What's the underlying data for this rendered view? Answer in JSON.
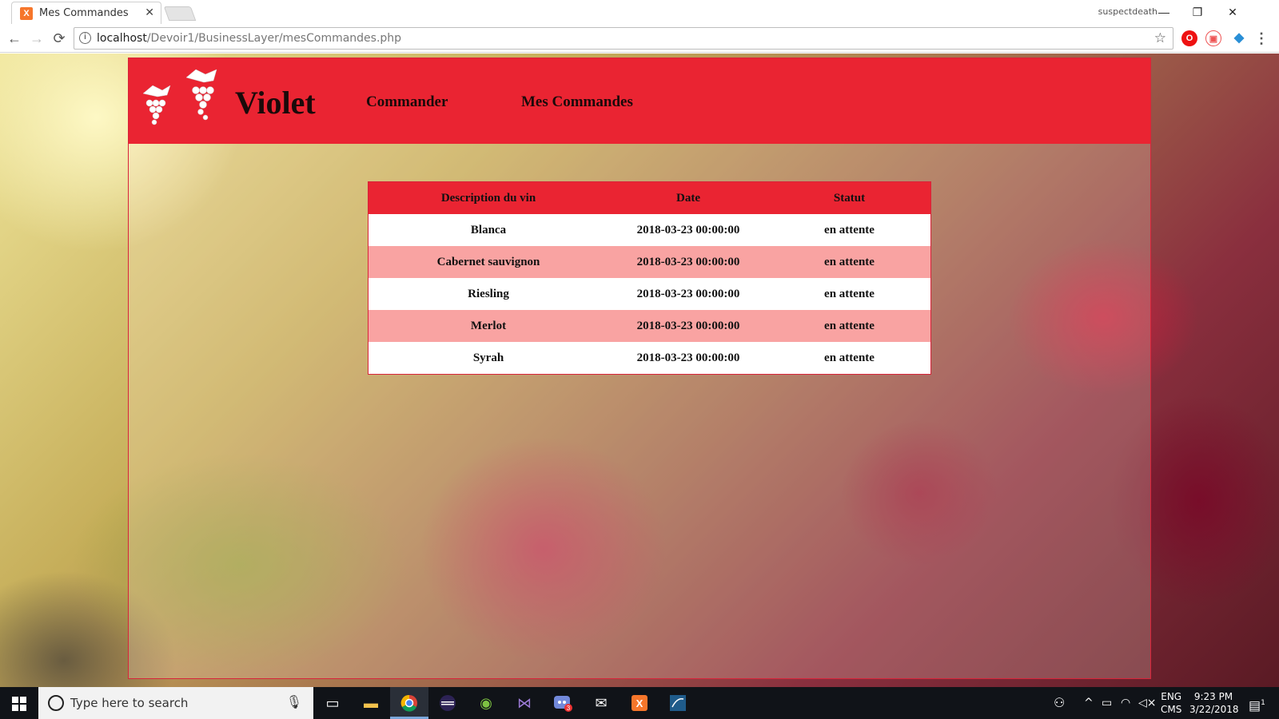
{
  "browser": {
    "tab_title": "Mes Commandes",
    "tab_close": "✕",
    "favicon_text": "X",
    "user_name": "suspectdeath",
    "url_host": "localhost",
    "url_path": "/Devoir1/BusinessLayer/mesCommandes.php",
    "back": "←",
    "forward": "→",
    "reload": "⟳",
    "bookmark": "☆",
    "minimize": "—",
    "restore": "❐",
    "close": "✕",
    "menu": "⋮"
  },
  "site": {
    "brand": "Violet",
    "nav": [
      "Commander",
      "Mes Commandes"
    ],
    "accent_color": "#ea2432",
    "row_alt_color": "#f9a3a2"
  },
  "orders": {
    "headers": [
      "Description du vin",
      "Date",
      "Statut"
    ],
    "rows": [
      {
        "wine": "Blanca",
        "date": "2018-03-23 00:00:00",
        "status": "en attente"
      },
      {
        "wine": "Cabernet sauvignon",
        "date": "2018-03-23 00:00:00",
        "status": "en attente"
      },
      {
        "wine": "Riesling",
        "date": "2018-03-23 00:00:00",
        "status": "en attente"
      },
      {
        "wine": "Merlot",
        "date": "2018-03-23 00:00:00",
        "status": "en attente"
      },
      {
        "wine": "Syrah",
        "date": "2018-03-23 00:00:00",
        "status": "en attente"
      }
    ]
  },
  "taskbar": {
    "search_placeholder": "Type here to search",
    "language_top": "ENG",
    "language_bottom": "CMS",
    "time": "9:23 PM",
    "date": "3/22/2018",
    "notification_count": "1",
    "discord_badge": "3",
    "apps": [
      "task-view-icon",
      "file-explorer-icon",
      "chrome-icon",
      "eclipse-icon",
      "android-studio-icon",
      "visual-studio-icon",
      "discord-icon",
      "mail-icon",
      "xampp-icon",
      "mysql-workbench-icon"
    ]
  }
}
